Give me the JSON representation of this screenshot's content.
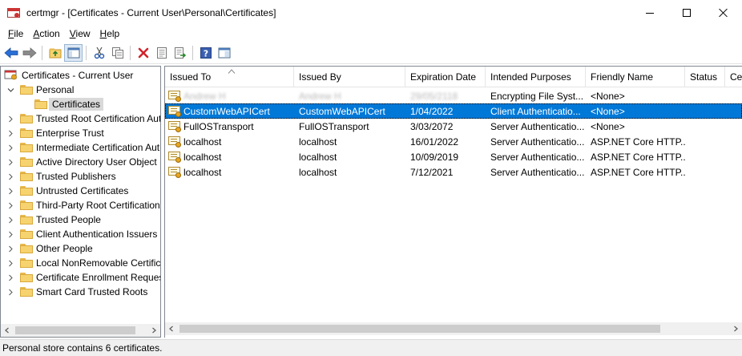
{
  "window": {
    "title": "certmgr - [Certificates - Current User\\Personal\\Certificates]",
    "icon": "certmgr-app-icon",
    "controls": [
      "minimize-icon",
      "maximize-icon",
      "close-icon"
    ]
  },
  "menu": [
    {
      "accel": "F",
      "rest": "ile"
    },
    {
      "accel": "A",
      "rest": "ction"
    },
    {
      "accel": "V",
      "rest": "iew"
    },
    {
      "accel": "H",
      "rest": "elp"
    }
  ],
  "toolbar": {
    "buttons": [
      "back-icon",
      "forward-icon",
      "up-folder-icon",
      "show-hide-tree-icon",
      "cut-icon",
      "copy-icon",
      "delete-icon",
      "properties-icon",
      "export-list-icon",
      "help-icon",
      "mmc-icon"
    ]
  },
  "tree": {
    "root": "Certificates - Current User",
    "personal": "Personal",
    "personal_child": "Certificates",
    "stores": [
      "Trusted Root Certification Authorities",
      "Enterprise Trust",
      "Intermediate Certification Authorities",
      "Active Directory User Object",
      "Trusted Publishers",
      "Untrusted Certificates",
      "Third-Party Root Certification Authorities",
      "Trusted People",
      "Client Authentication Issuers",
      "Other People",
      "Local NonRemovable Certificates",
      "Certificate Enrollment Requests",
      "Smart Card Trusted Roots"
    ]
  },
  "list": {
    "columns": [
      "Issued To",
      "Issued By",
      "Expiration Date",
      "Intended Purposes",
      "Friendly Name",
      "Status",
      "Certificate Template"
    ],
    "rows": [
      {
        "issued_to": "Andrew H",
        "issued_by": "Andrew H",
        "expiration": "29/05/2118",
        "purposes": "Encrypting File Syst...",
        "friendly": "<None>",
        "redacted": true
      },
      {
        "issued_to": "CustomWebAPICert",
        "issued_by": "CustomWebAPICert",
        "expiration": "1/04/2022",
        "purposes": "Client Authenticatio...",
        "friendly": "<None>",
        "selected": true
      },
      {
        "issued_to": "FullOSTransport",
        "issued_by": "FullOSTransport",
        "expiration": "3/03/2072",
        "purposes": "Server Authenticatio...",
        "friendly": "<None>"
      },
      {
        "issued_to": "localhost",
        "issued_by": "localhost",
        "expiration": "16/01/2022",
        "purposes": "Server Authenticatio...",
        "friendly": "ASP.NET Core HTTP..."
      },
      {
        "issued_to": "localhost",
        "issued_by": "localhost",
        "expiration": "10/09/2019",
        "purposes": "Server Authenticatio...",
        "friendly": "ASP.NET Core HTTP..."
      },
      {
        "issued_to": "localhost",
        "issued_by": "localhost",
        "expiration": "7/12/2021",
        "purposes": "Server Authenticatio...",
        "friendly": "ASP.NET Core HTTP..."
      }
    ]
  },
  "status": "Personal store contains 6 certificates.",
  "colors": {
    "selection": "#0078d7",
    "tree_selection": "#d9d9d9",
    "folder": "#f6d36f"
  }
}
